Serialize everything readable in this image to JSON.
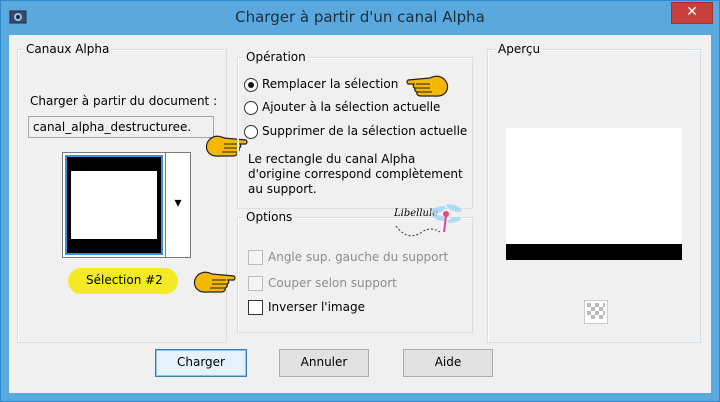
{
  "window": {
    "title": "Charger à partir d'un canal Alpha",
    "close_glyph": "✕"
  },
  "alpha_channels": {
    "legend": "Canaux Alpha",
    "load_from_label": "Charger à partir du document :",
    "document_value": "canal_alpha_destructuree.",
    "selection_name": "Sélection #2",
    "dropdown_glyph": "▾"
  },
  "operation": {
    "legend": "Opération",
    "options": [
      {
        "label": "Remplacer la sélection",
        "checked": true
      },
      {
        "label": "Ajouter à la sélection actuelle",
        "checked": false
      },
      {
        "label": "Supprimer de la sélection actuelle",
        "checked": false
      }
    ],
    "description": [
      "Le rectangle du canal Alpha",
      "d'origine correspond complètement",
      "au support."
    ]
  },
  "options": {
    "legend": "Options",
    "watermark": "Libellule",
    "items": [
      {
        "label": "Angle sup. gauche du support",
        "enabled": false,
        "checked": false
      },
      {
        "label": "Couper selon support",
        "enabled": false,
        "checked": false
      },
      {
        "label": "Inverser l'image",
        "enabled": true,
        "checked": false
      }
    ]
  },
  "preview": {
    "legend": "Aperçu"
  },
  "buttons": {
    "load": "Charger",
    "cancel": "Annuler",
    "help": "Aide"
  },
  "colors": {
    "titlebar": "#5aa9de",
    "highlight": "#f3ea25",
    "hand": "#f5b800"
  }
}
